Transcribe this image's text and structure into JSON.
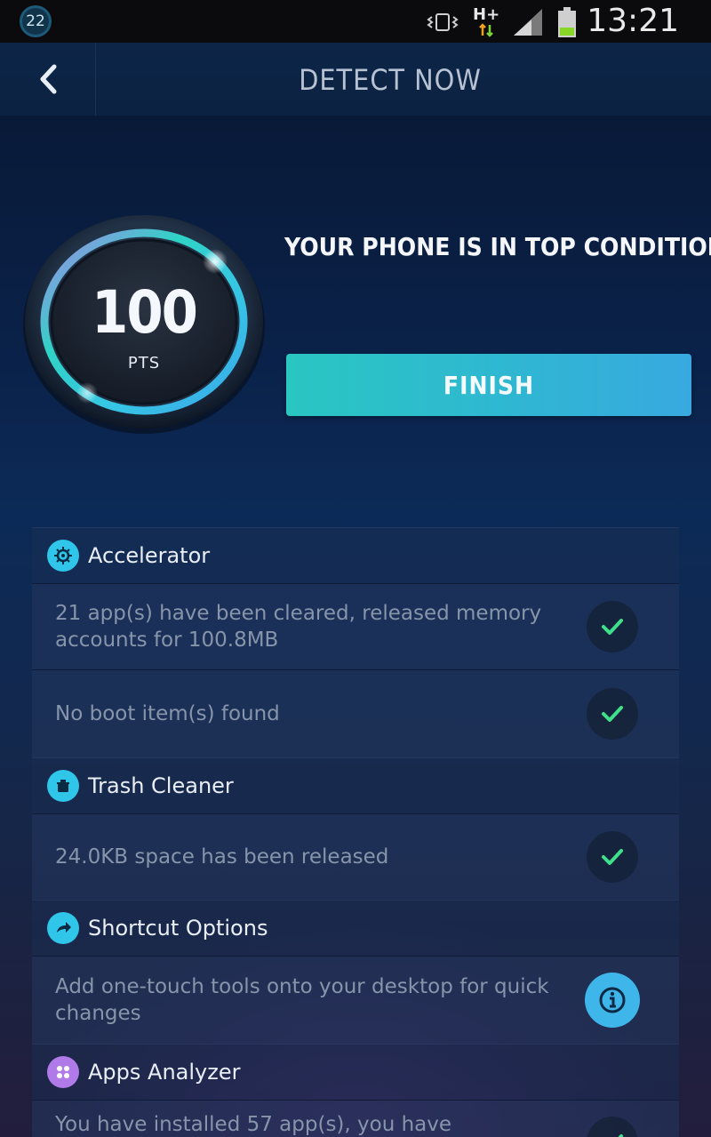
{
  "status_bar": {
    "notification_count": "22",
    "network_label": "H+",
    "time": "13:21",
    "icons": [
      "vibrate-icon",
      "network-hplus-icon",
      "signal-icon",
      "battery-icon"
    ]
  },
  "header": {
    "back_icon": "chevron-left-icon",
    "title": "DETECT NOW"
  },
  "score": {
    "value": "100",
    "unit": "PTS",
    "condition_text": "YOUR PHONE IS IN TOP CONDITION!",
    "finish_label": "FINISH"
  },
  "sections": [
    {
      "title": "Accelerator",
      "icon": "accelerator-icon",
      "items": [
        {
          "text": "21 app(s) have been cleared, released memory accounts for 100.8MB",
          "status": "check"
        },
        {
          "text": "No boot item(s) found",
          "status": "check"
        }
      ]
    },
    {
      "title": "Trash Cleaner",
      "icon": "trash-cleaner-icon",
      "items": [
        {
          "text": "24.0KB space has been released",
          "status": "check"
        }
      ]
    },
    {
      "title": "Shortcut Options",
      "icon": "shortcut-arrow-icon",
      "items": [
        {
          "text": "Add one-touch tools onto your desktop for quick changes",
          "status": "info"
        }
      ]
    },
    {
      "title": "Apps Analyzer",
      "icon": "apps-analyzer-icon",
      "items": [
        {
          "text": "You have installed 57 app(s), you have",
          "status": "check"
        }
      ]
    }
  ],
  "colors": {
    "accent_teal": "#2ac6c2",
    "accent_blue": "#38a9e0",
    "check_green": "#3fe08a",
    "info_blue": "#3fb6ea",
    "purple": "#b07be8"
  }
}
